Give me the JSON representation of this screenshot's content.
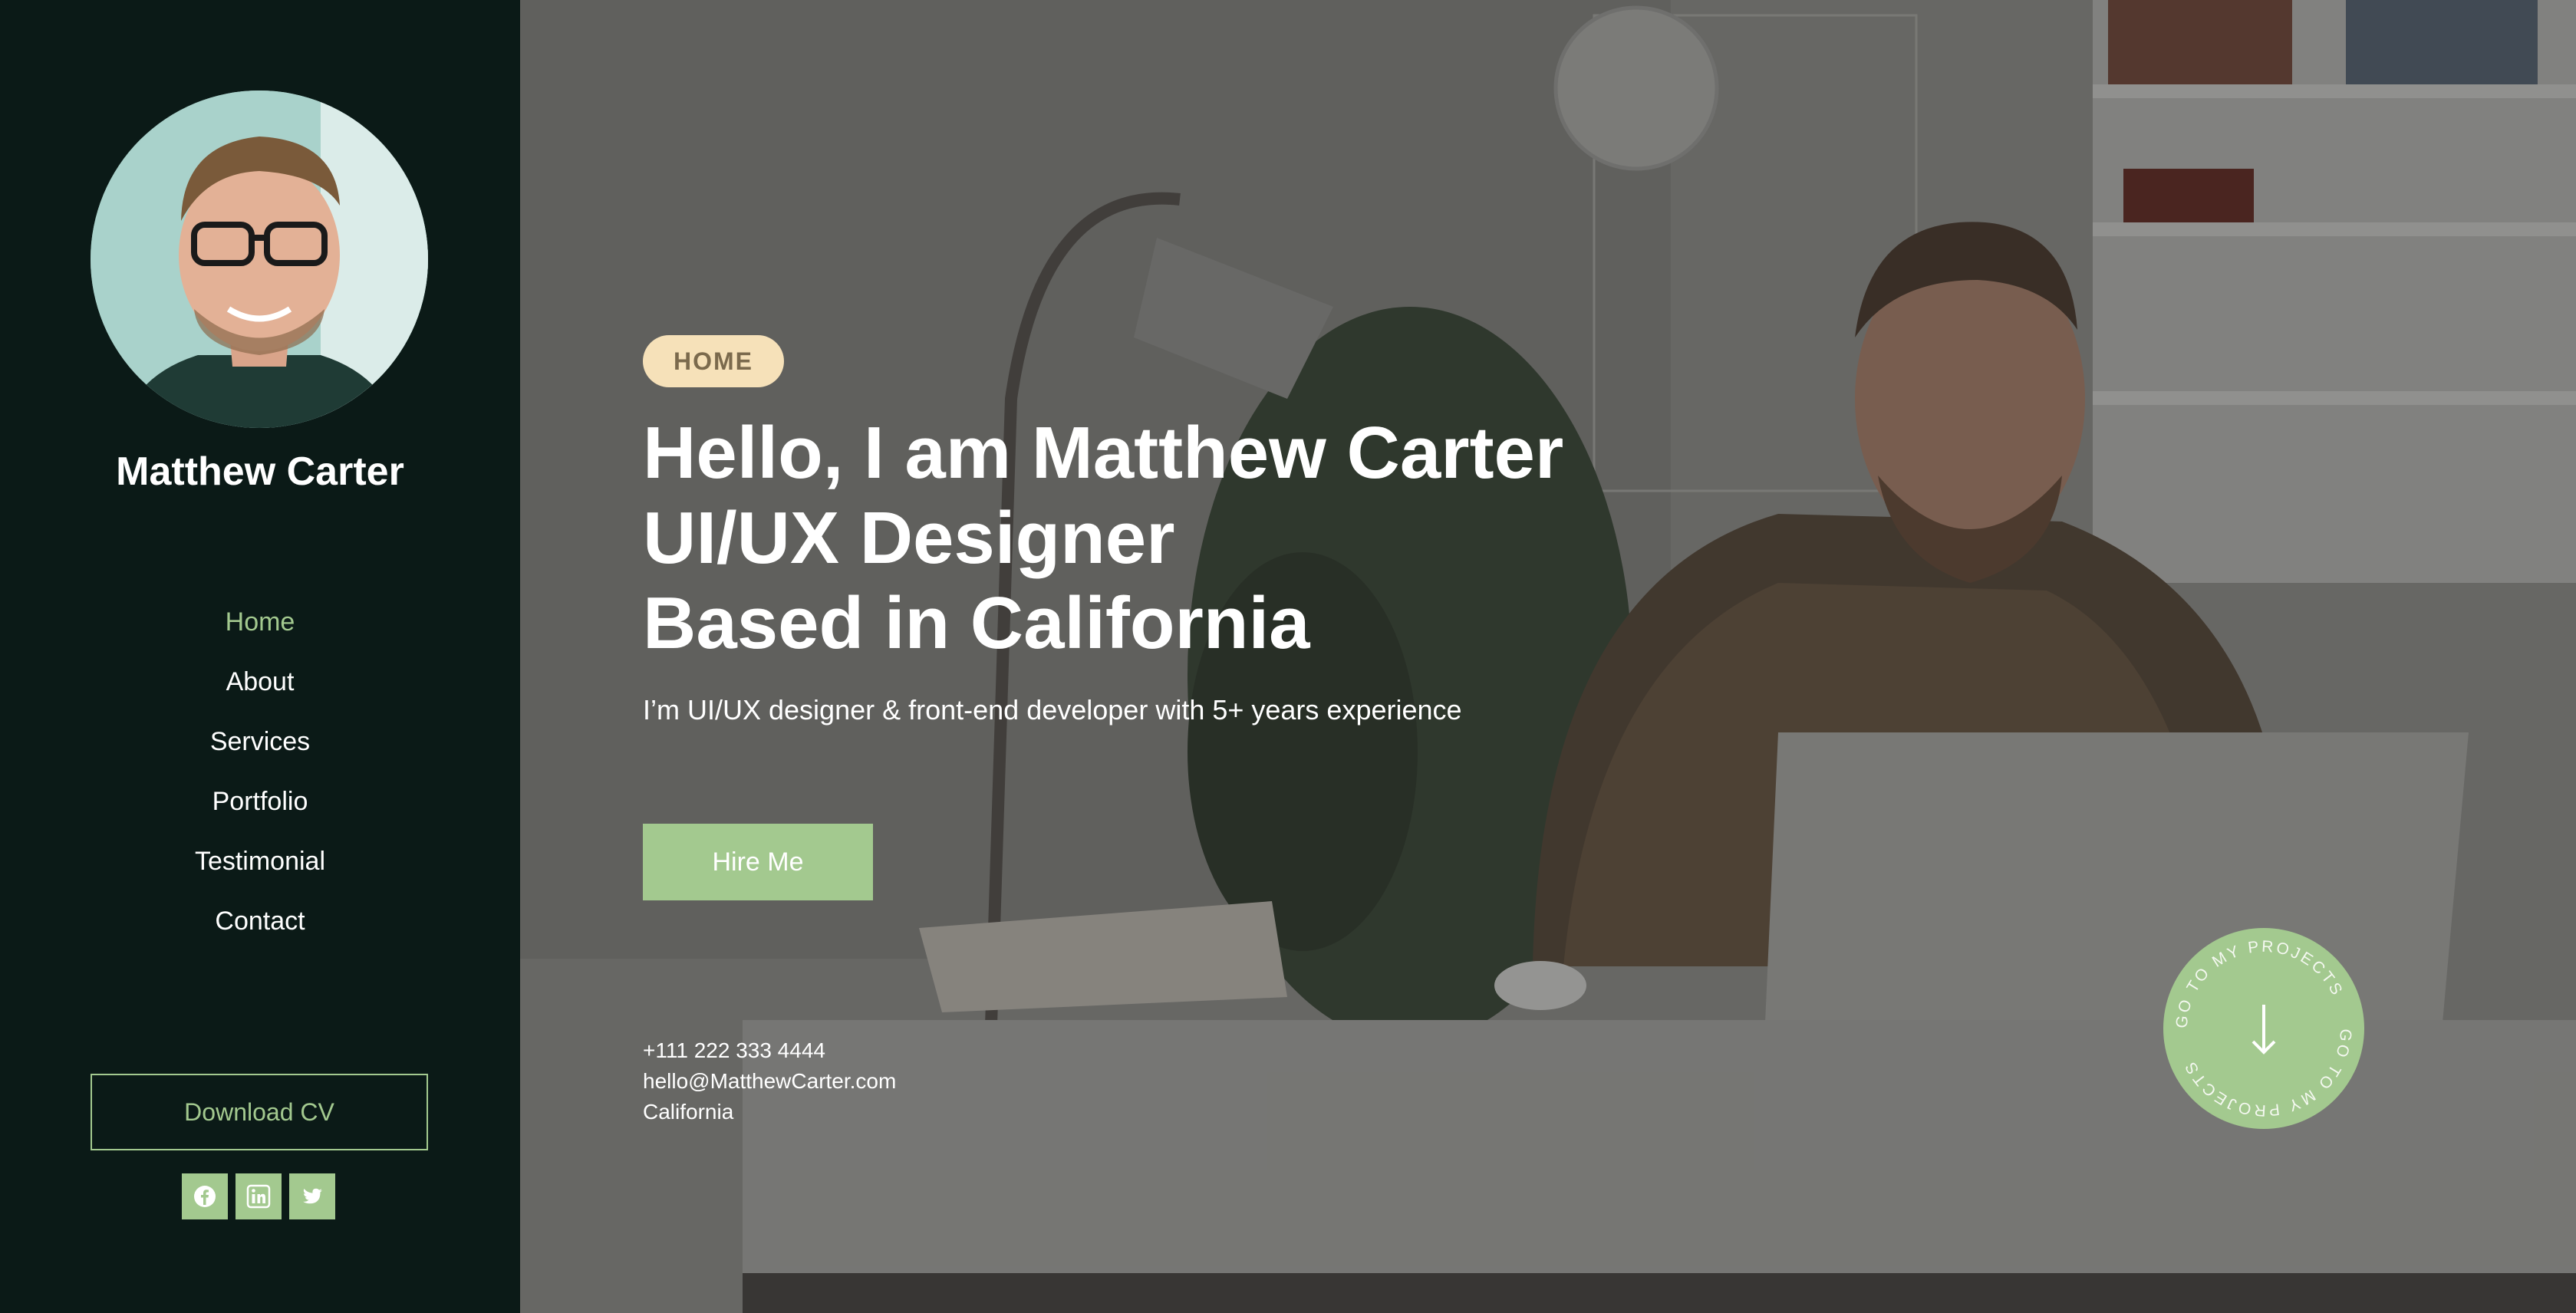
{
  "sidebar": {
    "name": "Matthew Carter",
    "nav": [
      {
        "label": "Home",
        "active": true
      },
      {
        "label": "About",
        "active": false
      },
      {
        "label": "Services",
        "active": false
      },
      {
        "label": "Portfolio",
        "active": false
      },
      {
        "label": "Testimonial",
        "active": false
      },
      {
        "label": "Contact",
        "active": false
      }
    ],
    "download_label": "Download CV",
    "socials": [
      "facebook-icon",
      "linkedin-icon",
      "twitter-icon"
    ]
  },
  "hero": {
    "badge": "HOME",
    "headline": [
      "Hello, I am Matthew Carter",
      "UI/UX Designer",
      "Based in California"
    ],
    "subline": "I’m UI/UX designer & front-end developer with 5+ years experience",
    "hire_label": "Hire Me",
    "contact": {
      "phone": "+111 222 333 4444",
      "email": "hello@MatthewCarter.com",
      "location": "California"
    },
    "scroll_text": "GO TO MY PROJECTS",
    "scroll_icon": "arrow-down-icon"
  },
  "colors": {
    "sidebar_bg": "#0b1a17",
    "accent": "#a3c98f",
    "badge_bg": "#f6e1b9"
  }
}
